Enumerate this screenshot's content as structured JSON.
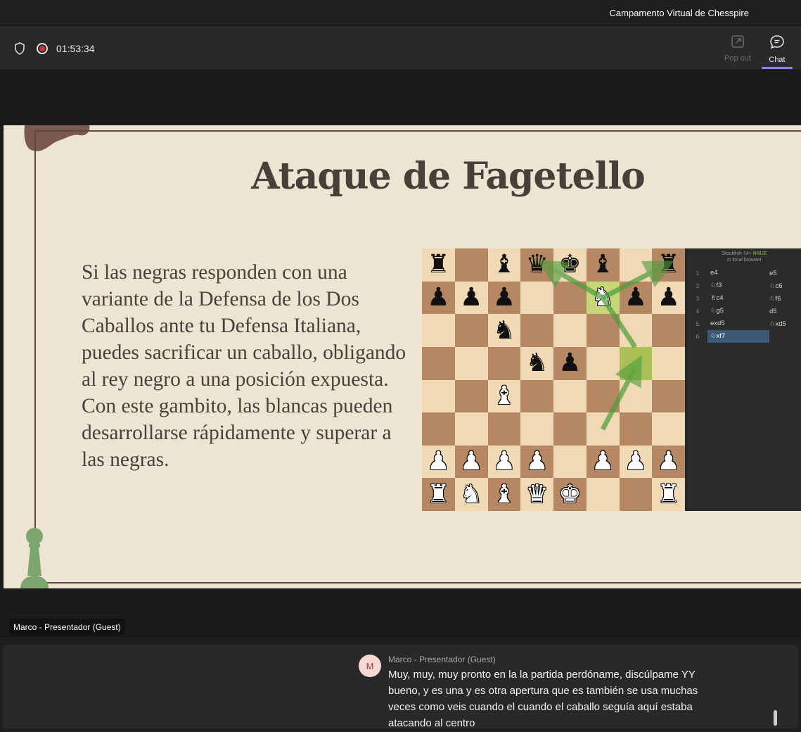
{
  "window": {
    "title": "Campamento Virtual de Chesspire"
  },
  "toolbar": {
    "timer": "01:53:34",
    "popout_label": "Pop out",
    "chat_label": "Chat"
  },
  "slide": {
    "title": "Ataque de Fagetello",
    "body": "Si las negras responden con una variante de la Defensa de los Dos Caballos ante tu Defensa Italiana, puedes sacrificar un caballo, obligando al rey negro a una posición expuesta. Con este gambito, las blancas pueden desarrollarse rápidamente y superar a las negras."
  },
  "chess": {
    "board": [
      [
        "br",
        "",
        "bb",
        "bq",
        "bk",
        "bb",
        "",
        "br"
      ],
      [
        "bp",
        "bp",
        "bp",
        "",
        "",
        "wn",
        "bp",
        "bp"
      ],
      [
        "",
        "",
        "bn",
        "",
        "",
        "",
        "",
        ""
      ],
      [
        "",
        "",
        "",
        "bn",
        "bp",
        "",
        "",
        ""
      ],
      [
        "",
        "",
        "wb",
        "",
        "",
        "",
        "",
        ""
      ],
      [
        "",
        "",
        "",
        "",
        "",
        "",
        "",
        ""
      ],
      [
        "wp",
        "wp",
        "wp",
        "wp",
        "",
        "wp",
        "wp",
        "wp"
      ],
      [
        "wr",
        "wn",
        "wb",
        "wq",
        "wk",
        "",
        "",
        "wr"
      ]
    ],
    "engine_name": "Stockfish 14+",
    "engine_tag": "NNUE",
    "engine_sub": "in local browser",
    "moves": [
      {
        "n": "1",
        "w": "e4",
        "b": "e5"
      },
      {
        "n": "2",
        "w": "♘f3",
        "b": "♘c6"
      },
      {
        "n": "3",
        "w": "♗c4",
        "b": "♘f6"
      },
      {
        "n": "4",
        "w": "♘g5",
        "b": "d5"
      },
      {
        "n": "5",
        "w": "exd5",
        "b": "♘xd5"
      },
      {
        "n": "6",
        "w": "♘xf7",
        "b": ""
      }
    ]
  },
  "presenter": {
    "name_tag": "Marco - Presentador (Guest)"
  },
  "chat": {
    "avatar_initial": "M",
    "sender": "Marco - Presentador (Guest)",
    "message": "Muy, muy, muy pronto en la la partida perdóname, discúlpame YY bueno, y es una y es otra apertura que es también se usa muchas veces como veis cuando el cuando el caballo seguía aquí estaba atacando al centro"
  },
  "colors": {
    "slide_bg": "#ede4d3",
    "board_light": "#f0d9b5",
    "board_dark": "#b58863",
    "highlight": "#aac056",
    "accent": "#7f85f5",
    "record": "#d13438"
  }
}
